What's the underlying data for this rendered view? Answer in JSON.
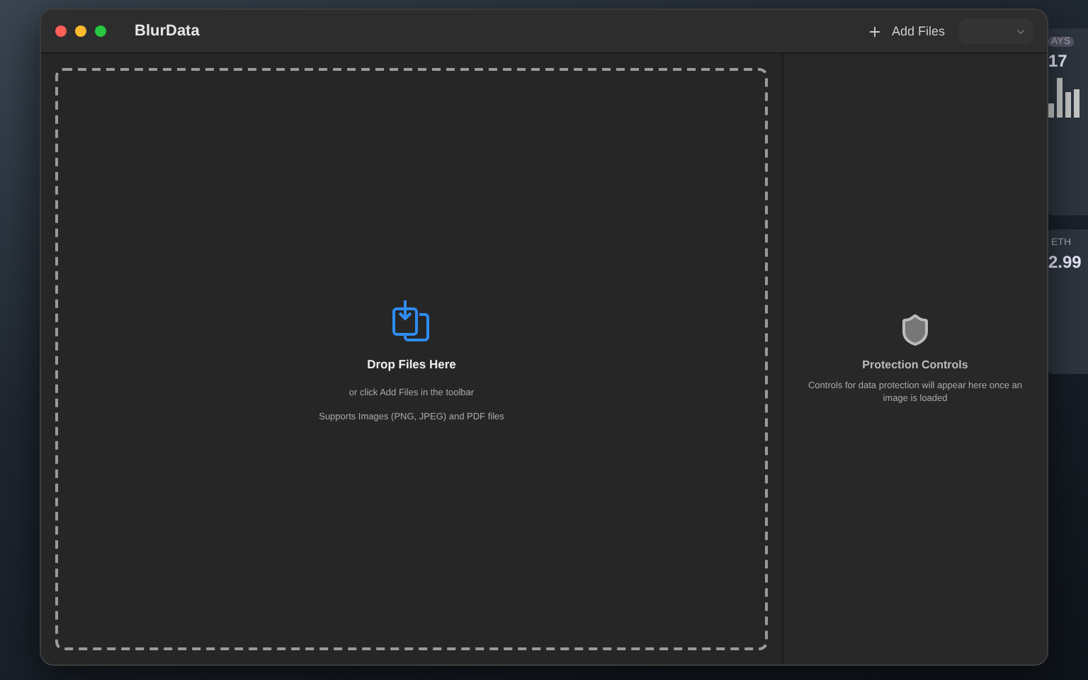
{
  "window": {
    "title": "BlurData"
  },
  "toolbar": {
    "add_button": "Add Files",
    "menu_button": {
      "disabled": true
    }
  },
  "drop_zone": {
    "title": "Drop Files Here",
    "hint": "or click Add Files in the toolbar",
    "support": "Supports Images (PNG, JPEG) and PDF files"
  },
  "sidebar": {
    "title": "Protection Controls",
    "message": "Controls for data protection will appear here once an image is loaded"
  },
  "background_widgets": [
    {
      "kind": "counter",
      "label": "AYS",
      "value": "17"
    },
    {
      "kind": "price",
      "label": "ETH",
      "value": "2.99"
    }
  ]
}
